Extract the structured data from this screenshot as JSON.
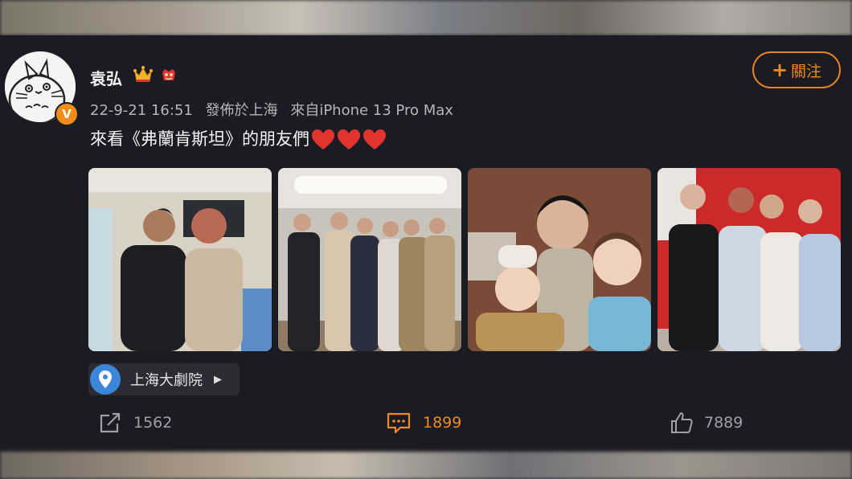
{
  "user": {
    "name": "袁弘",
    "verified_badge": "V",
    "timestamp": "22-9-21 16:51",
    "location_text": "發佈於上海",
    "device": "來自iPhone 13 Pro Max",
    "avatar_icon": "totoro-avatar-icon"
  },
  "follow": {
    "plus": "+",
    "label": "關注"
  },
  "post": {
    "text": "來看《弗蘭肯斯坦》的朋友們",
    "hearts": 3,
    "heart_color": "#e3342f"
  },
  "photos": [
    {
      "name": "photo-1-two-men-backstage"
    },
    {
      "name": "photo-2-group-hallway"
    },
    {
      "name": "photo-3-selfie-peace-signs"
    },
    {
      "name": "photo-4-group-red-backdrop"
    }
  ],
  "place": {
    "label": "上海大劇院",
    "icon": "location-pin-icon",
    "arrow": "▶"
  },
  "actions": {
    "repost_count": "1562",
    "comment_count": "1899",
    "like_count": "7889"
  },
  "colors": {
    "background": "#1b1c23",
    "accent": "#ec8a25",
    "location_pin": "#3b86d8"
  }
}
